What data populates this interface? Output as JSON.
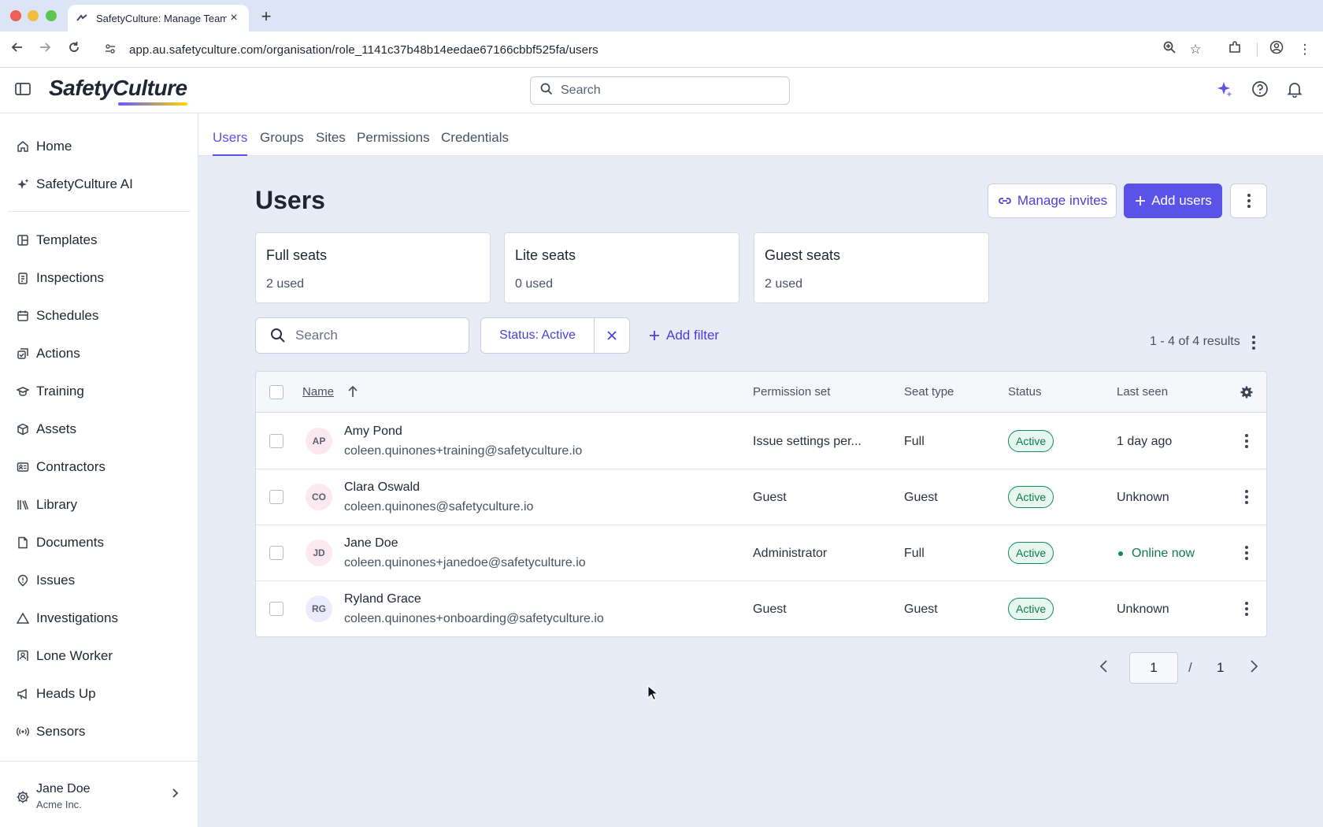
{
  "browser": {
    "tab_title": "SafetyCulture: Manage Team",
    "url": "app.au.safetyculture.com/organisation/role_1141c37b48b14eedae67166cbbf525fa/users"
  },
  "header": {
    "logo": "SafetyCulture",
    "search_placeholder": "Search"
  },
  "sidebar": {
    "top_items": [
      {
        "label": "Home",
        "icon": "home-icon"
      },
      {
        "label": "SafetyCulture AI",
        "icon": "sparkle-icon"
      }
    ],
    "items": [
      {
        "label": "Templates",
        "icon": "template-icon"
      },
      {
        "label": "Inspections",
        "icon": "inspection-icon"
      },
      {
        "label": "Schedules",
        "icon": "calendar-icon"
      },
      {
        "label": "Actions",
        "icon": "actions-icon"
      },
      {
        "label": "Training",
        "icon": "training-icon"
      },
      {
        "label": "Assets",
        "icon": "cube-icon"
      },
      {
        "label": "Contractors",
        "icon": "id-card-icon"
      },
      {
        "label": "Library",
        "icon": "library-icon"
      },
      {
        "label": "Documents",
        "icon": "document-icon"
      },
      {
        "label": "Issues",
        "icon": "issue-icon"
      },
      {
        "label": "Investigations",
        "icon": "triangle-icon"
      },
      {
        "label": "Lone Worker",
        "icon": "lone-worker-icon"
      },
      {
        "label": "Heads Up",
        "icon": "megaphone-icon"
      },
      {
        "label": "Sensors",
        "icon": "sensor-icon"
      }
    ],
    "footer": {
      "name": "Jane Doe",
      "org": "Acme Inc."
    }
  },
  "subtabs": [
    "Users",
    "Groups",
    "Sites",
    "Permissions",
    "Credentials"
  ],
  "page": {
    "title": "Users",
    "manage_invites": "Manage invites",
    "add_users": "Add users"
  },
  "seats": [
    {
      "title": "Full seats",
      "used": "2 used"
    },
    {
      "title": "Lite seats",
      "used": "0 used"
    },
    {
      "title": "Guest seats",
      "used": "2 used"
    }
  ],
  "filters": {
    "search_placeholder": "Search",
    "status_chip": "Status: Active",
    "add_filter": "Add filter",
    "results": "1 - 4 of 4 results"
  },
  "table": {
    "columns": {
      "name": "Name",
      "permission": "Permission set",
      "seat": "Seat type",
      "status": "Status",
      "last_seen": "Last seen"
    },
    "rows": [
      {
        "initials": "AP",
        "name": "Amy Pond",
        "email": "coleen.quinones+training@safetyculture.io",
        "permission": "Issue settings per...",
        "seat": "Full",
        "status": "Active",
        "last_seen": "1 day ago",
        "avatar_bg": "#fce8ef"
      },
      {
        "initials": "CO",
        "name": "Clara Oswald",
        "email": "coleen.quinones@safetyculture.io",
        "permission": "Guest",
        "seat": "Guest",
        "status": "Active",
        "last_seen": "Unknown",
        "avatar_bg": "#fce8ef"
      },
      {
        "initials": "JD",
        "name": "Jane Doe",
        "email": "coleen.quinones+janedoe@safetyculture.io",
        "permission": "Administrator",
        "seat": "Full",
        "status": "Active",
        "last_seen": "Online now",
        "avatar_bg": "#fce8ef"
      },
      {
        "initials": "RG",
        "name": "Ryland Grace",
        "email": "coleen.quinones+onboarding@safetyculture.io",
        "permission": "Guest",
        "seat": "Guest",
        "status": "Active",
        "last_seen": "Unknown",
        "avatar_bg": "#eceafd"
      }
    ]
  },
  "pagination": {
    "current": "1",
    "separator": "/",
    "total": "1"
  },
  "colors": {
    "accent": "#5b52e8",
    "active_badge": "#0f8a5f"
  }
}
